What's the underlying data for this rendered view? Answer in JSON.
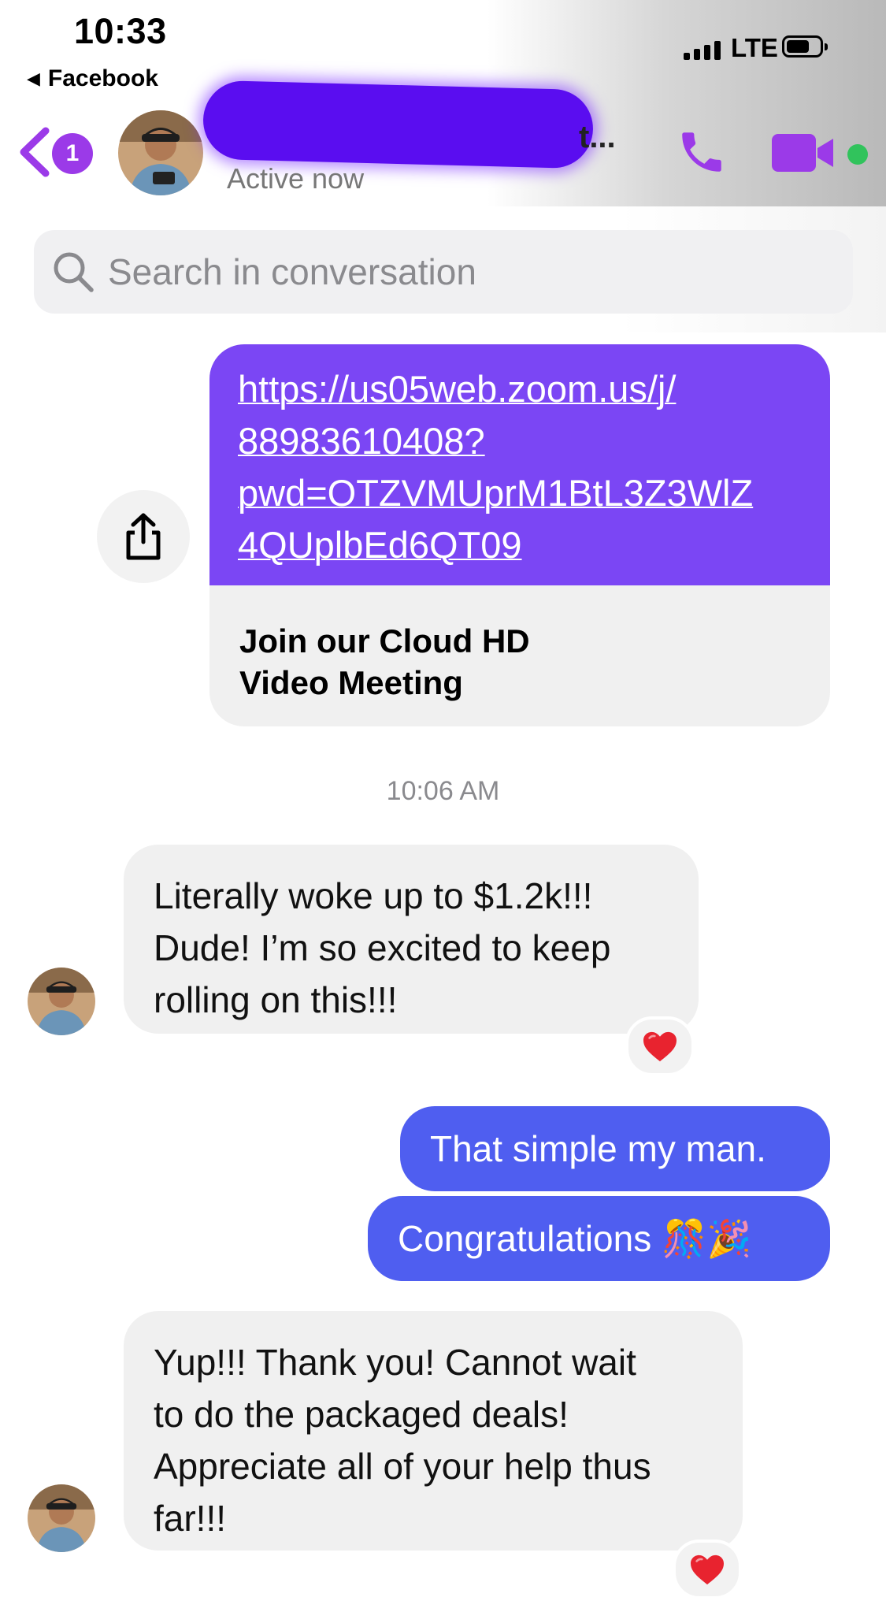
{
  "status_bar": {
    "time": "10:33",
    "back_app": "Facebook",
    "network": "LTE"
  },
  "header": {
    "unread_count": "1",
    "name_trailing": "t...",
    "presence": "Active now",
    "online_color": "#31c35c",
    "accent_color": "#9b3ae8"
  },
  "search": {
    "placeholder": "Search in conversation"
  },
  "messages": {
    "link": {
      "url": "https://us05web.zoom.us/j/88983610408?pwd=OTZVMUprM1BtL3Z3WlZ4QUplbEd6QT09",
      "line1": "https://us05web.zoom.us/j/",
      "line2": "88983610408?",
      "line3": "pwd=OTZVMUprM1BtL3Z3WlZ",
      "line4": "4QUplbEd6QT09",
      "title_line1": "Join our Cloud HD",
      "title_line2": "Video Meeting"
    },
    "timestamp": "10:06 AM",
    "incoming_1": {
      "line1": "Literally woke up to $1.2k!!!",
      "line2": "Dude! I’m so excited to keep",
      "line3": "rolling on this!!!",
      "reaction": "❤️"
    },
    "outgoing_1": "That simple my man.",
    "outgoing_2": "Congratulations 🎊🎉",
    "incoming_2": {
      "line1": "Yup!!! Thank you! Cannot wait",
      "line2": "to do the packaged deals!",
      "line3": "Appreciate all of your help thus",
      "line4": "far!!!",
      "reaction": "❤️"
    }
  },
  "icons": {
    "back": "chevron-left-icon",
    "call": "phone-icon",
    "video": "video-camera-icon",
    "search": "search-icon",
    "share": "share-icon"
  }
}
